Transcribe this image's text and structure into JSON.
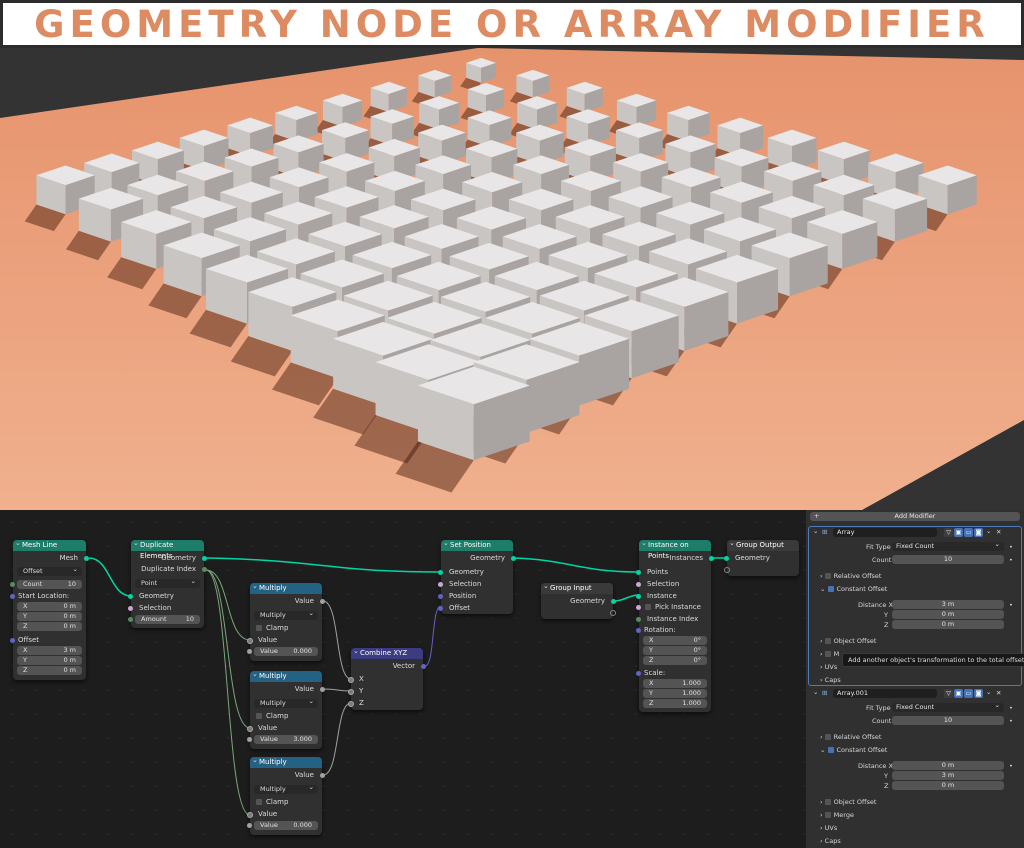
{
  "banner": {
    "title": "GEOMETRY NODE OR ARRAY MODIFIER"
  },
  "colors": {
    "banner_text": "#dd8b62",
    "ground": "#e9a07a",
    "node_geometry_header": "#1e7d68",
    "node_math_header": "#246283",
    "node_vector_header": "#3c3c83",
    "geometry_socket": "#00d6a3",
    "vector_socket": "#6363c7"
  },
  "scene": {
    "grid": "10 x 10 cubes",
    "ground": "orange plane"
  },
  "nodes": {
    "mesh_line": {
      "title": "Mesh Line",
      "out_mesh": "Mesh",
      "mode": "Offset",
      "count_label": "Count",
      "count_value": "10",
      "start_label": "Start Location:",
      "start": [
        {
          "k": "X",
          "v": "0 m"
        },
        {
          "k": "Y",
          "v": "0 m"
        },
        {
          "k": "Z",
          "v": "0 m"
        }
      ],
      "offset_label": "Offset",
      "offset": [
        {
          "k": "X",
          "v": "3 m"
        },
        {
          "k": "Y",
          "v": "0 m"
        },
        {
          "k": "Z",
          "v": "0 m"
        }
      ]
    },
    "duplicate": {
      "title": "Duplicate Elements",
      "out_geometry": "Geometry",
      "out_index": "Duplicate Index",
      "domain": "Point",
      "in_geometry": "Geometry",
      "in_selection": "Selection",
      "amount_label": "Amount",
      "amount_value": "10"
    },
    "multiply1": {
      "title": "Multiply",
      "out_value": "Value",
      "op": "Multiply",
      "clamp": "Clamp",
      "in_value": "Value",
      "field_label": "Value",
      "field_value": "0.000"
    },
    "multiply2": {
      "title": "Multiply",
      "out_value": "Value",
      "op": "Multiply",
      "clamp": "Clamp",
      "in_value": "Value",
      "field_label": "Value",
      "field_value": "3.000"
    },
    "multiply3": {
      "title": "Multiply",
      "out_value": "Value",
      "op": "Multiply",
      "clamp": "Clamp",
      "in_value": "Value",
      "field_label": "Value",
      "field_value": "0.000"
    },
    "combine": {
      "title": "Combine XYZ",
      "out_vector": "Vector",
      "x": "X",
      "y": "Y",
      "z": "Z"
    },
    "set_position": {
      "title": "Set Position",
      "out_geometry": "Geometry",
      "in_geometry": "Geometry",
      "selection": "Selection",
      "position": "Position",
      "offset": "Offset"
    },
    "group_input": {
      "title": "Group Input",
      "out_geometry": "Geometry"
    },
    "instance": {
      "title": "Instance on Points",
      "out_instances": "Instances",
      "points": "Points",
      "selection": "Selection",
      "inst": "Instance",
      "pick": "Pick Instance",
      "index": "Instance Index",
      "rotation_label": "Rotation:",
      "rotation": [
        {
          "k": "X",
          "v": "0°"
        },
        {
          "k": "Y",
          "v": "0°"
        },
        {
          "k": "Z",
          "v": "0°"
        }
      ],
      "scale_label": "Scale:",
      "scale": [
        {
          "k": "X",
          "v": "1.000"
        },
        {
          "k": "Y",
          "v": "1.000"
        },
        {
          "k": "Z",
          "v": "1.000"
        }
      ]
    },
    "group_output": {
      "title": "Group Output",
      "in_geometry": "Geometry"
    }
  },
  "panel": {
    "add_modifier": "Add Modifier",
    "tooltip": "Add another object's transformation to the total offset.",
    "mod1": {
      "name": "Array",
      "fit_label": "Fit Type",
      "fit_value": "Fixed Count",
      "count_label": "Count",
      "count_value": "10",
      "relative": "Relative Offset",
      "constant": "Constant Offset",
      "dist": [
        {
          "k": "Distance X",
          "v": "3 m"
        },
        {
          "k": "Y",
          "v": "0 m"
        },
        {
          "k": "Z",
          "v": "0 m"
        }
      ],
      "object_offset": "Object Offset",
      "merge": "M",
      "uvs": "UVs",
      "caps": "Caps"
    },
    "mod2": {
      "name": "Array.001",
      "fit_label": "Fit Type",
      "fit_value": "Fixed Count",
      "count_label": "Count",
      "count_value": "10",
      "relative": "Relative Offset",
      "constant": "Constant Offset",
      "dist": [
        {
          "k": "Distance X",
          "v": "0 m"
        },
        {
          "k": "Y",
          "v": "3 m"
        },
        {
          "k": "Z",
          "v": "0 m"
        }
      ],
      "object_offset": "Object Offset",
      "merge": "Merge",
      "uvs": "UVs",
      "caps": "Caps"
    }
  }
}
